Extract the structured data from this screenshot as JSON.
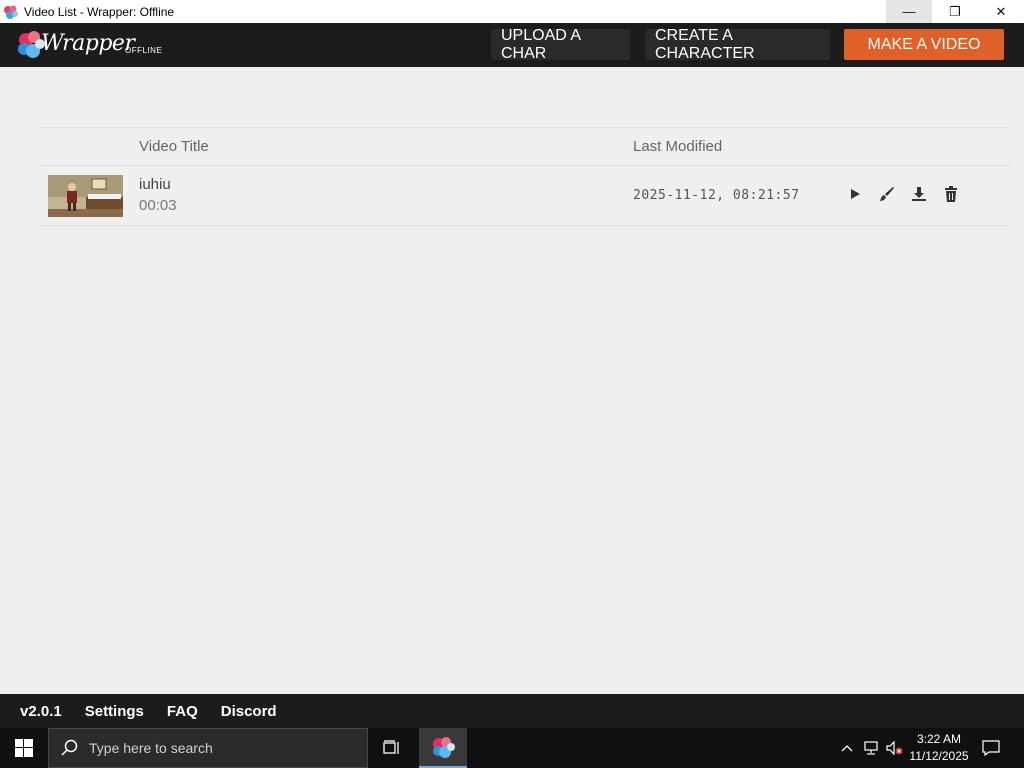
{
  "window": {
    "title": "Video List - Wrapper: Offline",
    "minimize": "—",
    "restore": "❐",
    "close": "✕"
  },
  "header": {
    "logo_word": "Wrapper",
    "logo_sub": "OFFLINE",
    "upload_label": "UPLOAD A CHAR",
    "create_label": "CREATE A CHARACTER",
    "make_label": "MAKE A VIDEO"
  },
  "table": {
    "columns": [
      "Video Title",
      "Last Modified"
    ],
    "rows": [
      {
        "title": "iuhiu",
        "duration": "00:03",
        "modified": "2025-11-12, 08:21:57"
      }
    ]
  },
  "footer": {
    "version": "v2.0.1",
    "links": [
      "Settings",
      "FAQ",
      "Discord"
    ]
  },
  "taskbar": {
    "search_placeholder": "Type here to search",
    "time": "3:22 AM",
    "date": "11/12/2025"
  },
  "colors": {
    "accent": "#e0602a",
    "header_bg": "#1c1c1c",
    "page_bg": "#efefef"
  },
  "icons": [
    "app-icon",
    "play-icon",
    "brush-icon",
    "download-icon",
    "trash-icon",
    "windows-logo-icon",
    "search-icon",
    "task-view-icon",
    "chevron-up-icon",
    "network-icon",
    "volume-muted-icon",
    "notification-icon"
  ]
}
